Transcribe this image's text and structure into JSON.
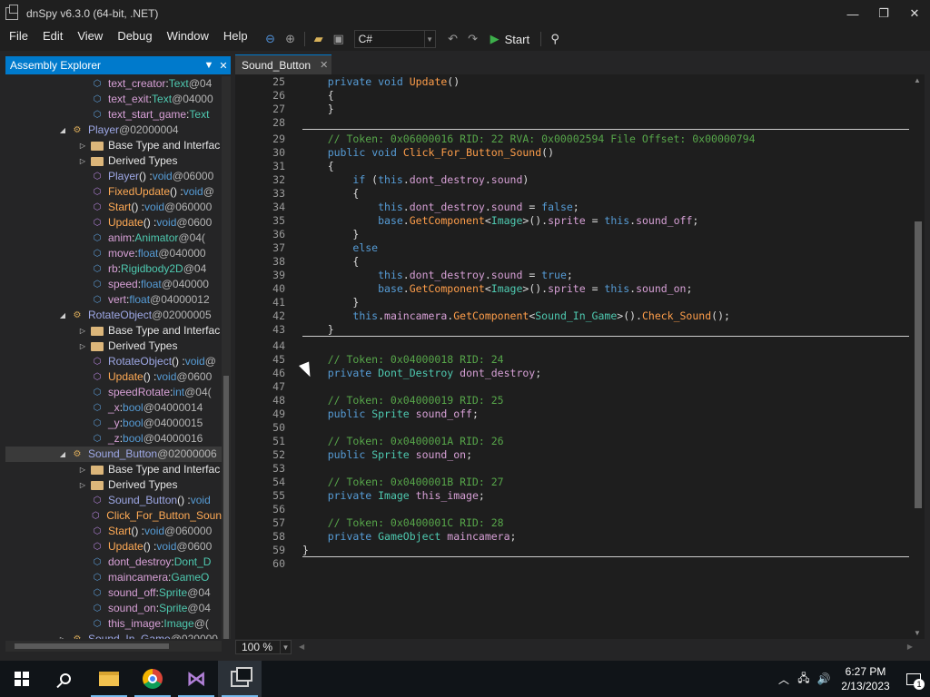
{
  "window": {
    "title": "dnSpy v6.3.0 (64-bit, .NET)",
    "minimize": "—",
    "restore": "❐",
    "close": "✕"
  },
  "menu": {
    "items": [
      "File",
      "Edit",
      "View",
      "Debug",
      "Window",
      "Help"
    ],
    "language": "C#",
    "start_label": "Start"
  },
  "explorer": {
    "title": "Assembly Explorer",
    "rows": [
      {
        "indent": 1,
        "exp": "",
        "icon": "field",
        "name": "text_creator",
        "sep": " : ",
        "type": "Text",
        "tok": " @04",
        "nameClass": "t-field"
      },
      {
        "indent": 1,
        "exp": "",
        "icon": "field",
        "name": "text_exit",
        "sep": " : ",
        "type": "Text",
        "tok": " @04000",
        "nameClass": "t-field"
      },
      {
        "indent": 1,
        "exp": "",
        "icon": "field",
        "name": "text_start_game",
        "sep": " : ",
        "type": "Text",
        "tok": "",
        "nameClass": "t-field"
      },
      {
        "indent": 0,
        "exp": "◢",
        "icon": "class",
        "name": "Player",
        "sep": "",
        "type": "",
        "tok": " @02000004",
        "nameClass": "t-class"
      },
      {
        "indent": 1,
        "exp": "▷",
        "icon": "folder",
        "name": "Base Type and Interfac",
        "sep": "",
        "type": "",
        "tok": "",
        "nameClass": "t-plain"
      },
      {
        "indent": 1,
        "exp": "▷",
        "icon": "folder",
        "name": "Derived Types",
        "sep": "",
        "type": "",
        "tok": "",
        "nameClass": "t-plain"
      },
      {
        "indent": 1,
        "exp": "",
        "icon": "method",
        "name": "Player",
        "sep": "() : ",
        "type": "void",
        "tok": " @06000",
        "nameClass": "t-class"
      },
      {
        "indent": 1,
        "exp": "",
        "icon": "lockm",
        "name": "FixedUpdate",
        "sep": "() : ",
        "type": "void",
        "tok": " @",
        "nameClass": "t-update"
      },
      {
        "indent": 1,
        "exp": "",
        "icon": "lockm",
        "name": "Start",
        "sep": "() : ",
        "type": "void",
        "tok": " @060000",
        "nameClass": "t-update"
      },
      {
        "indent": 1,
        "exp": "",
        "icon": "method",
        "name": "Update",
        "sep": "() : ",
        "type": "void",
        "tok": " @0600",
        "nameClass": "t-update"
      },
      {
        "indent": 1,
        "exp": "",
        "icon": "lockf",
        "name": "anim",
        "sep": " : ",
        "type": "Animator",
        "tok": " @04(",
        "nameClass": "t-field"
      },
      {
        "indent": 1,
        "exp": "",
        "icon": "lockf",
        "name": "move",
        "sep": " : ",
        "type": "float",
        "tok": " @040000",
        "nameClass": "t-field"
      },
      {
        "indent": 1,
        "exp": "",
        "icon": "lockf",
        "name": "rb",
        "sep": " : ",
        "type": "Rigidbody2D",
        "tok": " @04",
        "nameClass": "t-field"
      },
      {
        "indent": 1,
        "exp": "",
        "icon": "lockf",
        "name": "speed",
        "sep": " : ",
        "type": "float",
        "tok": " @040000",
        "nameClass": "t-field"
      },
      {
        "indent": 1,
        "exp": "",
        "icon": "lockf",
        "name": "vert",
        "sep": " : ",
        "type": "float",
        "tok": " @04000012",
        "nameClass": "t-field"
      },
      {
        "indent": 0,
        "exp": "◢",
        "icon": "class",
        "name": "RotateObject",
        "sep": "",
        "type": "",
        "tok": " @02000005",
        "nameClass": "t-class"
      },
      {
        "indent": 1,
        "exp": "▷",
        "icon": "folder",
        "name": "Base Type and Interfac",
        "sep": "",
        "type": "",
        "tok": "",
        "nameClass": "t-plain"
      },
      {
        "indent": 1,
        "exp": "▷",
        "icon": "folder",
        "name": "Derived Types",
        "sep": "",
        "type": "",
        "tok": "",
        "nameClass": "t-plain"
      },
      {
        "indent": 1,
        "exp": "",
        "icon": "method",
        "name": "RotateObject",
        "sep": "() : ",
        "type": "void",
        "tok": " @",
        "nameClass": "t-class"
      },
      {
        "indent": 1,
        "exp": "",
        "icon": "lockm",
        "name": "Update",
        "sep": "() : ",
        "type": "void",
        "tok": " @0600",
        "nameClass": "t-update"
      },
      {
        "indent": 1,
        "exp": "",
        "icon": "lockf",
        "name": "speedRotate",
        "sep": " : ",
        "type": "int",
        "tok": " @04(",
        "nameClass": "t-field"
      },
      {
        "indent": 1,
        "exp": "",
        "icon": "lockf",
        "name": "_x",
        "sep": " : ",
        "type": "bool",
        "tok": " @04000014",
        "nameClass": "t-field"
      },
      {
        "indent": 1,
        "exp": "",
        "icon": "lockf",
        "name": "_y",
        "sep": " : ",
        "type": "bool",
        "tok": " @04000015",
        "nameClass": "t-field"
      },
      {
        "indent": 1,
        "exp": "",
        "icon": "lockf",
        "name": "_z",
        "sep": " : ",
        "type": "bool",
        "tok": " @04000016",
        "nameClass": "t-field"
      },
      {
        "indent": 0,
        "exp": "◢",
        "icon": "class",
        "name": "Sound_Button",
        "sep": "",
        "type": "",
        "tok": " @02000006",
        "nameClass": "t-class",
        "selected": true
      },
      {
        "indent": 1,
        "exp": "▷",
        "icon": "folder",
        "name": "Base Type and Interfac",
        "sep": "",
        "type": "",
        "tok": "",
        "nameClass": "t-plain"
      },
      {
        "indent": 1,
        "exp": "▷",
        "icon": "folder",
        "name": "Derived Types",
        "sep": "",
        "type": "",
        "tok": "",
        "nameClass": "t-plain"
      },
      {
        "indent": 1,
        "exp": "",
        "icon": "method",
        "name": "Sound_Button",
        "sep": "() : ",
        "type": "void",
        "tok": "",
        "nameClass": "t-class"
      },
      {
        "indent": 1,
        "exp": "",
        "icon": "method",
        "name": "Click_For_Button_Soun",
        "sep": "",
        "type": "",
        "tok": "",
        "nameClass": "t-update"
      },
      {
        "indent": 1,
        "exp": "",
        "icon": "lockm",
        "name": "Start",
        "sep": "() : ",
        "type": "void",
        "tok": " @060000",
        "nameClass": "t-update"
      },
      {
        "indent": 1,
        "exp": "",
        "icon": "lockm",
        "name": "Update",
        "sep": "() : ",
        "type": "void",
        "tok": " @0600",
        "nameClass": "t-update"
      },
      {
        "indent": 1,
        "exp": "",
        "icon": "lockf",
        "name": "dont_destroy",
        "sep": " : ",
        "type": "Dont_D",
        "tok": "",
        "nameClass": "t-field"
      },
      {
        "indent": 1,
        "exp": "",
        "icon": "lockf",
        "name": "maincamera",
        "sep": " : ",
        "type": "GameO",
        "tok": "",
        "nameClass": "t-field"
      },
      {
        "indent": 1,
        "exp": "",
        "icon": "field",
        "name": "sound_off",
        "sep": " : ",
        "type": "Sprite",
        "tok": " @04",
        "nameClass": "t-field"
      },
      {
        "indent": 1,
        "exp": "",
        "icon": "field",
        "name": "sound_on",
        "sep": " : ",
        "type": "Sprite",
        "tok": " @04",
        "nameClass": "t-field"
      },
      {
        "indent": 1,
        "exp": "",
        "icon": "lockf",
        "name": "this_image",
        "sep": " : ",
        "type": "Image",
        "tok": " @(",
        "nameClass": "t-field"
      },
      {
        "indent": 0,
        "exp": "▷",
        "icon": "class",
        "name": "Sound_In_Game",
        "sep": "",
        "type": "",
        "tok": " @020000",
        "nameClass": "t-class"
      }
    ]
  },
  "editor": {
    "tab_label": "Sound_Button",
    "tab_close": "✕",
    "zoom": "100 %",
    "lines": [
      {
        "n": "25",
        "seg": [
          [
            "    ",
            "pl"
          ],
          [
            "private",
            "k"
          ],
          [
            " ",
            "pl"
          ],
          [
            "void",
            "k"
          ],
          [
            " ",
            "pl"
          ],
          [
            "Update",
            "fnc"
          ],
          [
            "()",
            "pl"
          ]
        ]
      },
      {
        "n": "26",
        "seg": [
          [
            "    {",
            "pl"
          ]
        ]
      },
      {
        "n": "27",
        "seg": [
          [
            "    }",
            "pl"
          ]
        ]
      },
      {
        "n": "28",
        "seg": [],
        "sep": true
      },
      {
        "n": "29",
        "seg": [
          [
            "    // Token: 0x06000016 RID: 22 RVA: 0x00002594 File Offset: 0x00000794",
            "cm"
          ]
        ]
      },
      {
        "n": "30",
        "seg": [
          [
            "    ",
            "pl"
          ],
          [
            "public",
            "k"
          ],
          [
            " ",
            "pl"
          ],
          [
            "void",
            "k"
          ],
          [
            " ",
            "pl"
          ],
          [
            "Click_For_Button_Sound",
            "fnc"
          ],
          [
            "()",
            "pl"
          ]
        ]
      },
      {
        "n": "31",
        "seg": [
          [
            "    {",
            "pl"
          ]
        ]
      },
      {
        "n": "32",
        "seg": [
          [
            "        ",
            "pl"
          ],
          [
            "if",
            "k"
          ],
          [
            " (",
            "pl"
          ],
          [
            "this",
            "k"
          ],
          [
            ".",
            "pl"
          ],
          [
            "dont_destroy",
            "fd"
          ],
          [
            ".",
            "pl"
          ],
          [
            "sound",
            "fd"
          ],
          [
            ")",
            "pl"
          ]
        ]
      },
      {
        "n": "33",
        "seg": [
          [
            "        {",
            "pl"
          ]
        ]
      },
      {
        "n": "34",
        "seg": [
          [
            "            ",
            "pl"
          ],
          [
            "this",
            "k"
          ],
          [
            ".",
            "pl"
          ],
          [
            "dont_destroy",
            "fd"
          ],
          [
            ".",
            "pl"
          ],
          [
            "sound",
            "fd"
          ],
          [
            " = ",
            "pl"
          ],
          [
            "false",
            "k"
          ],
          [
            ";",
            "pl"
          ]
        ]
      },
      {
        "n": "35",
        "seg": [
          [
            "            ",
            "pl"
          ],
          [
            "base",
            "k"
          ],
          [
            ".",
            "pl"
          ],
          [
            "GetComponent",
            "fnc"
          ],
          [
            "<",
            "pl"
          ],
          [
            "Image",
            "ty"
          ],
          [
            ">().",
            "pl"
          ],
          [
            "sprite",
            "fd"
          ],
          [
            " = ",
            "pl"
          ],
          [
            "this",
            "k"
          ],
          [
            ".",
            "pl"
          ],
          [
            "sound_off",
            "fd"
          ],
          [
            ";",
            "pl"
          ]
        ]
      },
      {
        "n": "36",
        "seg": [
          [
            "        }",
            "pl"
          ]
        ]
      },
      {
        "n": "37",
        "seg": [
          [
            "        ",
            "pl"
          ],
          [
            "else",
            "k"
          ]
        ]
      },
      {
        "n": "38",
        "seg": [
          [
            "        {",
            "pl"
          ]
        ]
      },
      {
        "n": "39",
        "seg": [
          [
            "            ",
            "pl"
          ],
          [
            "this",
            "k"
          ],
          [
            ".",
            "pl"
          ],
          [
            "dont_destroy",
            "fd"
          ],
          [
            ".",
            "pl"
          ],
          [
            "sound",
            "fd"
          ],
          [
            " = ",
            "pl"
          ],
          [
            "true",
            "k"
          ],
          [
            ";",
            "pl"
          ]
        ]
      },
      {
        "n": "40",
        "seg": [
          [
            "            ",
            "pl"
          ],
          [
            "base",
            "k"
          ],
          [
            ".",
            "pl"
          ],
          [
            "GetComponent",
            "fnc"
          ],
          [
            "<",
            "pl"
          ],
          [
            "Image",
            "ty"
          ],
          [
            ">().",
            "pl"
          ],
          [
            "sprite",
            "fd"
          ],
          [
            " = ",
            "pl"
          ],
          [
            "this",
            "k"
          ],
          [
            ".",
            "pl"
          ],
          [
            "sound_on",
            "fd"
          ],
          [
            ";",
            "pl"
          ]
        ]
      },
      {
        "n": "41",
        "seg": [
          [
            "        }",
            "pl"
          ]
        ]
      },
      {
        "n": "42",
        "seg": [
          [
            "        ",
            "pl"
          ],
          [
            "this",
            "k"
          ],
          [
            ".",
            "pl"
          ],
          [
            "maincamera",
            "fd"
          ],
          [
            ".",
            "pl"
          ],
          [
            "GetComponent",
            "fnc"
          ],
          [
            "<",
            "pl"
          ],
          [
            "Sound_In_Game",
            "ty"
          ],
          [
            ">().",
            "pl"
          ],
          [
            "Check_Sound",
            "fnc"
          ],
          [
            "();",
            "pl"
          ]
        ]
      },
      {
        "n": "43",
        "seg": [
          [
            "    }",
            "pl"
          ]
        ],
        "sep": true
      },
      {
        "n": "44",
        "seg": []
      },
      {
        "n": "45",
        "seg": [
          [
            "    // Token: 0x04000018 RID: 24",
            "cm"
          ]
        ]
      },
      {
        "n": "46",
        "seg": [
          [
            "    ",
            "pl"
          ],
          [
            "private",
            "k"
          ],
          [
            " ",
            "pl"
          ],
          [
            "Dont_Destroy",
            "ty"
          ],
          [
            " ",
            "pl"
          ],
          [
            "dont_destroy",
            "fd"
          ],
          [
            ";",
            "pl"
          ]
        ]
      },
      {
        "n": "47",
        "seg": []
      },
      {
        "n": "48",
        "seg": [
          [
            "    // Token: 0x04000019 RID: 25",
            "cm"
          ]
        ]
      },
      {
        "n": "49",
        "seg": [
          [
            "    ",
            "pl"
          ],
          [
            "public",
            "k"
          ],
          [
            " ",
            "pl"
          ],
          [
            "Sprite",
            "ty"
          ],
          [
            " ",
            "pl"
          ],
          [
            "sound_off",
            "fd"
          ],
          [
            ";",
            "pl"
          ]
        ]
      },
      {
        "n": "50",
        "seg": []
      },
      {
        "n": "51",
        "seg": [
          [
            "    // Token: 0x0400001A RID: 26",
            "cm"
          ]
        ]
      },
      {
        "n": "52",
        "seg": [
          [
            "    ",
            "pl"
          ],
          [
            "public",
            "k"
          ],
          [
            " ",
            "pl"
          ],
          [
            "Sprite",
            "ty"
          ],
          [
            " ",
            "pl"
          ],
          [
            "sound_on",
            "fd"
          ],
          [
            ";",
            "pl"
          ]
        ]
      },
      {
        "n": "53",
        "seg": []
      },
      {
        "n": "54",
        "seg": [
          [
            "    // Token: 0x0400001B RID: 27",
            "cm"
          ]
        ]
      },
      {
        "n": "55",
        "seg": [
          [
            "    ",
            "pl"
          ],
          [
            "private",
            "k"
          ],
          [
            " ",
            "pl"
          ],
          [
            "Image",
            "ty"
          ],
          [
            " ",
            "pl"
          ],
          [
            "this_image",
            "fd"
          ],
          [
            ";",
            "pl"
          ]
        ]
      },
      {
        "n": "56",
        "seg": []
      },
      {
        "n": "57",
        "seg": [
          [
            "    // Token: 0x0400001C RID: 28",
            "cm"
          ]
        ]
      },
      {
        "n": "58",
        "seg": [
          [
            "    ",
            "pl"
          ],
          [
            "private",
            "k"
          ],
          [
            " ",
            "pl"
          ],
          [
            "GameObject",
            "ty"
          ],
          [
            " ",
            "pl"
          ],
          [
            "maincamera",
            "fd"
          ],
          [
            ";",
            "pl"
          ]
        ]
      },
      {
        "n": "59",
        "seg": [
          [
            "}",
            "pl"
          ]
        ],
        "sep": true
      },
      {
        "n": "60",
        "seg": []
      }
    ]
  },
  "taskbar": {
    "time": "6:27 PM",
    "date": "2/13/2023",
    "notifications": "1"
  }
}
